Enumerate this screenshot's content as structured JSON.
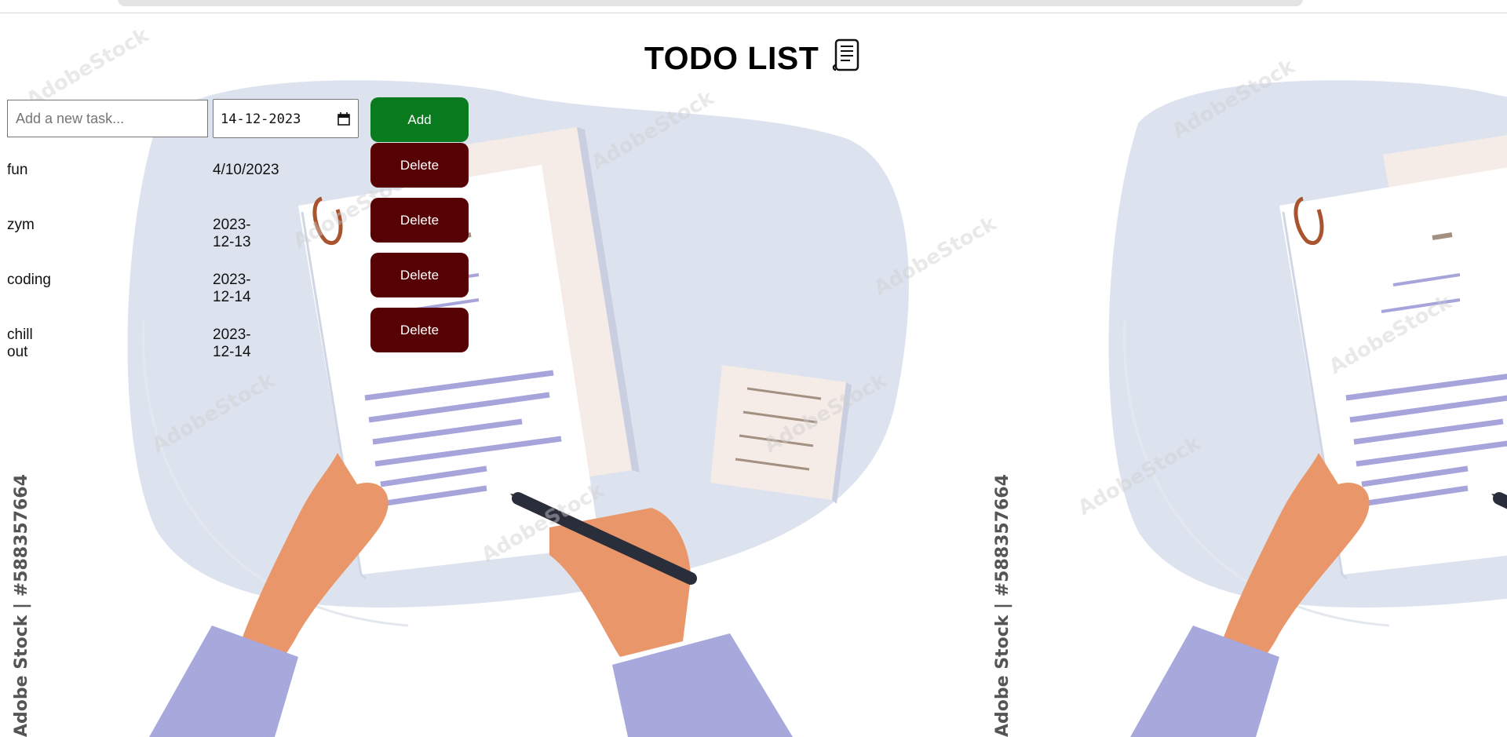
{
  "page": {
    "title": "TODO LIST",
    "title_icon": "scroll-icon"
  },
  "form": {
    "task_placeholder": "Add a new task...",
    "date_value": "14-12-2023",
    "add_label": "Add"
  },
  "tasks": [
    {
      "name": "fun",
      "date": "4/10/2023",
      "delete_label": "Delete"
    },
    {
      "name": "zym",
      "date": "2023-12-13",
      "delete_label": "Delete"
    },
    {
      "name": "coding",
      "date": "2023-12-14",
      "delete_label": "Delete"
    },
    {
      "name": "chill out",
      "date": "2023-12-14",
      "delete_label": "Delete"
    }
  ],
  "background": {
    "credit": "Adobe Stock | #588357664",
    "watermark": "AdobeStock"
  },
  "colors": {
    "add": "#0a7a1f",
    "delete": "#560104",
    "blob": "#dde3ee",
    "sleeve": "#a7a8dc",
    "skin": "#e9976a",
    "paper_lines": "#a7a4dc"
  }
}
